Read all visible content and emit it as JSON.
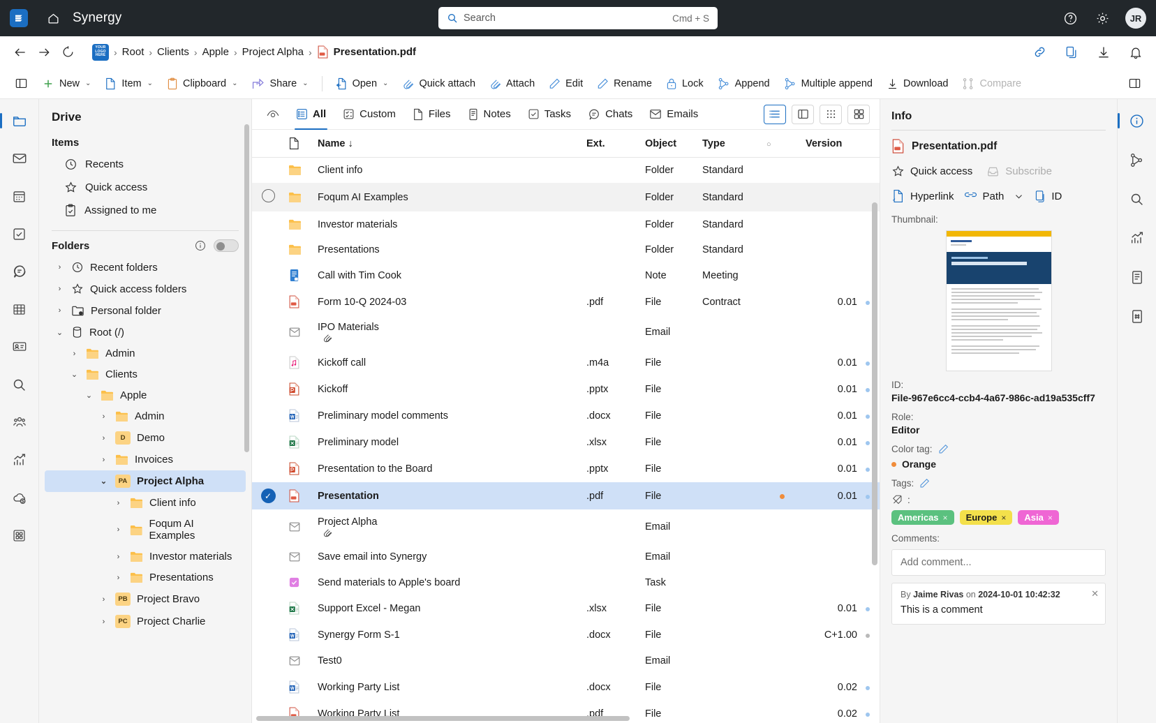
{
  "topbar": {
    "app_title": "Synergy",
    "search_placeholder": "Search",
    "search_shortcut": "Cmd + S",
    "avatar_initials": "JR"
  },
  "breadcrumb": {
    "items": [
      "Root",
      "Clients",
      "Apple",
      "Project Alpha"
    ],
    "current": "Presentation.pdf",
    "separator": "›"
  },
  "commandbar": {
    "new": "New",
    "item": "Item",
    "clipboard": "Clipboard",
    "share": "Share",
    "open": "Open",
    "quick_attach": "Quick attach",
    "attach": "Attach",
    "edit": "Edit",
    "rename": "Rename",
    "lock": "Lock",
    "append": "Append",
    "multiple_append": "Multiple append",
    "download": "Download",
    "compare": "Compare",
    "chevron": "⌄"
  },
  "sidebar": {
    "header": "Drive",
    "items_section": "Items",
    "items": [
      {
        "label": "Recents",
        "icon": "clock-icon"
      },
      {
        "label": "Quick access",
        "icon": "star-icon"
      },
      {
        "label": "Assigned to me",
        "icon": "clipboard-check-icon"
      }
    ],
    "folders_section": "Folders",
    "tree": [
      {
        "label": "Recent folders",
        "indent": 0,
        "arrow": "›",
        "icon": "clock",
        "selected": false
      },
      {
        "label": "Quick access folders",
        "indent": 0,
        "arrow": "›",
        "icon": "star",
        "selected": false
      },
      {
        "label": "Personal folder",
        "indent": 0,
        "arrow": "›",
        "icon": "personal",
        "selected": false
      },
      {
        "label": "Root (/)",
        "indent": 0,
        "arrow": "⌄",
        "icon": "db",
        "selected": false
      },
      {
        "label": "Admin",
        "indent": 1,
        "arrow": "›",
        "icon": "folder",
        "selected": false
      },
      {
        "label": "Clients",
        "indent": 1,
        "arrow": "⌄",
        "icon": "folder",
        "selected": false
      },
      {
        "label": "Apple",
        "indent": 2,
        "arrow": "⌄",
        "icon": "folder",
        "selected": false
      },
      {
        "label": "Admin",
        "indent": 3,
        "arrow": "›",
        "icon": "folder",
        "selected": false
      },
      {
        "label": "Demo",
        "indent": 3,
        "arrow": "›",
        "icon": "badge",
        "badge": "D",
        "selected": false
      },
      {
        "label": "Invoices",
        "indent": 3,
        "arrow": "›",
        "icon": "folder",
        "selected": false
      },
      {
        "label": "Project Alpha",
        "indent": 3,
        "arrow": "⌄",
        "icon": "badge",
        "badge": "PA",
        "selected": true
      },
      {
        "label": "Client info",
        "indent": 4,
        "arrow": "›",
        "icon": "folder",
        "selected": false
      },
      {
        "label": "Foqum AI Examples",
        "indent": 4,
        "arrow": "›",
        "icon": "folder",
        "selected": false
      },
      {
        "label": "Investor materials",
        "indent": 4,
        "arrow": "›",
        "icon": "folder",
        "selected": false
      },
      {
        "label": "Presentations",
        "indent": 4,
        "arrow": "›",
        "icon": "folder",
        "selected": false
      },
      {
        "label": "Project Bravo",
        "indent": 3,
        "arrow": "›",
        "icon": "badge",
        "badge": "PB",
        "selected": false
      },
      {
        "label": "Project Charlie",
        "indent": 3,
        "arrow": "›",
        "icon": "badge",
        "badge": "PC",
        "selected": false
      }
    ]
  },
  "main": {
    "tabs": [
      {
        "label": "All",
        "icon": "list-icon",
        "active": true
      },
      {
        "label": "Custom",
        "icon": "custom-icon",
        "active": false
      },
      {
        "label": "Files",
        "icon": "file-icon",
        "active": false
      },
      {
        "label": "Notes",
        "icon": "note-icon",
        "active": false
      },
      {
        "label": "Tasks",
        "icon": "task-icon",
        "active": false
      },
      {
        "label": "Chats",
        "icon": "chat-icon",
        "active": false
      },
      {
        "label": "Emails",
        "icon": "email-icon",
        "active": false
      }
    ],
    "columns": [
      "",
      "",
      "Name ↓",
      "Ext.",
      "Object",
      "Type",
      "○",
      "Version"
    ],
    "rows": [
      {
        "name": "Client info",
        "ext": "",
        "object": "Folder",
        "type": "Standard",
        "version": "",
        "icon": "folder",
        "state": ""
      },
      {
        "name": "Foqum AI Examples",
        "ext": "",
        "object": "Folder",
        "type": "Standard",
        "version": "",
        "icon": "folder",
        "state": "hover"
      },
      {
        "name": "Investor materials",
        "ext": "",
        "object": "Folder",
        "type": "Standard",
        "version": "",
        "icon": "folder",
        "state": ""
      },
      {
        "name": "Presentations",
        "ext": "",
        "object": "Folder",
        "type": "Standard",
        "version": "",
        "icon": "folder",
        "state": ""
      },
      {
        "name": "Call with Tim Cook",
        "ext": "",
        "object": "Note",
        "type": "Meeting",
        "version": "",
        "icon": "note",
        "state": ""
      },
      {
        "name": "Form 10-Q 2024-03",
        "ext": ".pdf",
        "object": "File",
        "type": "Contract",
        "version": "0.01",
        "icon": "pdf",
        "state": ""
      },
      {
        "name": "IPO Materials",
        "ext": "",
        "object": "Email",
        "type": "",
        "version": "",
        "icon": "email",
        "state": "",
        "clip": true
      },
      {
        "name": "Kickoff call",
        "ext": ".m4a",
        "object": "File",
        "type": "",
        "version": "0.01",
        "icon": "audio",
        "state": ""
      },
      {
        "name": "Kickoff",
        "ext": ".pptx",
        "object": "File",
        "type": "",
        "version": "0.01",
        "icon": "ppt",
        "state": ""
      },
      {
        "name": "Preliminary model comments",
        "ext": ".docx",
        "object": "File",
        "type": "",
        "version": "0.01",
        "icon": "word",
        "state": ""
      },
      {
        "name": "Preliminary model",
        "ext": ".xlsx",
        "object": "File",
        "type": "",
        "version": "0.01",
        "icon": "excel",
        "state": ""
      },
      {
        "name": "Presentation to the Board",
        "ext": ".pptx",
        "object": "File",
        "type": "",
        "version": "0.01",
        "icon": "ppt",
        "state": ""
      },
      {
        "name": "Presentation",
        "ext": ".pdf",
        "object": "File",
        "type": "",
        "version": "0.01",
        "icon": "pdf",
        "state": "selected",
        "orange_dot": true
      },
      {
        "name": "Project Alpha",
        "ext": "",
        "object": "Email",
        "type": "",
        "version": "",
        "icon": "email",
        "state": "",
        "clip": true
      },
      {
        "name": "Save email into Synergy",
        "ext": "",
        "object": "Email",
        "type": "",
        "version": "",
        "icon": "email",
        "state": ""
      },
      {
        "name": "Send materials to Apple's board",
        "ext": "",
        "object": "Task",
        "type": "",
        "version": "",
        "icon": "task",
        "state": ""
      },
      {
        "name": "Support Excel - Megan",
        "ext": ".xlsx",
        "object": "File",
        "type": "",
        "version": "0.01",
        "icon": "excel",
        "state": ""
      },
      {
        "name": "Synergy Form S-1",
        "ext": ".docx",
        "object": "File",
        "type": "",
        "version": "C+1.00",
        "icon": "word",
        "state": "",
        "grey_dot": true
      },
      {
        "name": "Test0",
        "ext": "",
        "object": "Email",
        "type": "",
        "version": "",
        "icon": "email",
        "state": ""
      },
      {
        "name": "Working Party List",
        "ext": ".docx",
        "object": "File",
        "type": "",
        "version": "0.02",
        "icon": "word",
        "state": ""
      },
      {
        "name": "Working Party List",
        "ext": ".pdf",
        "object": "File",
        "type": "",
        "version": "0.02",
        "icon": "pdf",
        "state": ""
      }
    ]
  },
  "info": {
    "title": "Info",
    "filename": "Presentation.pdf",
    "quick_access": "Quick access",
    "subscribe": "Subscribe",
    "hyperlink": "Hyperlink",
    "path": "Path",
    "id_btn": "ID",
    "thumbnail_label": "Thumbnail:",
    "id_label": "ID:",
    "id_value": "File-967e6cc4-ccb4-4a67-986c-ad19a535cff7",
    "role_label": "Role:",
    "role_value": "Editor",
    "colortag_label": "Color tag:",
    "colortag_value": "Orange",
    "colortag_hex": "#f08c3a",
    "tags_label": "Tags:",
    "tags_prefix": ":",
    "tags": [
      {
        "label": "Americas",
        "bg": "#5bc17f",
        "fg": "#ffffff"
      },
      {
        "label": "Europe",
        "bg": "#f3e04b",
        "fg": "#1b1b1b"
      },
      {
        "label": "Asia",
        "bg": "#ef66d4",
        "fg": "#ffffff"
      }
    ],
    "tag_remove": "×",
    "comments_label": "Comments:",
    "comment_placeholder": "Add comment...",
    "comment_by_prefix": "By",
    "comment_author": "Jaime Rivas",
    "comment_on": "on",
    "comment_date": "2024-10-01 10:42:32",
    "comment_text": "This is a comment"
  },
  "rails": {
    "left": [
      "folder-icon",
      "mail-icon",
      "calendar-icon",
      "task-icon",
      "chat-icon",
      "table-icon",
      "contact-card-icon",
      "search-icon",
      "people-icon",
      "analytics-icon",
      "cloud-sync-icon",
      "apps-icon"
    ],
    "right": [
      "info-icon",
      "versions-icon",
      "search-icon",
      "analytics-icon",
      "document-icon",
      "numbering-icon"
    ]
  }
}
